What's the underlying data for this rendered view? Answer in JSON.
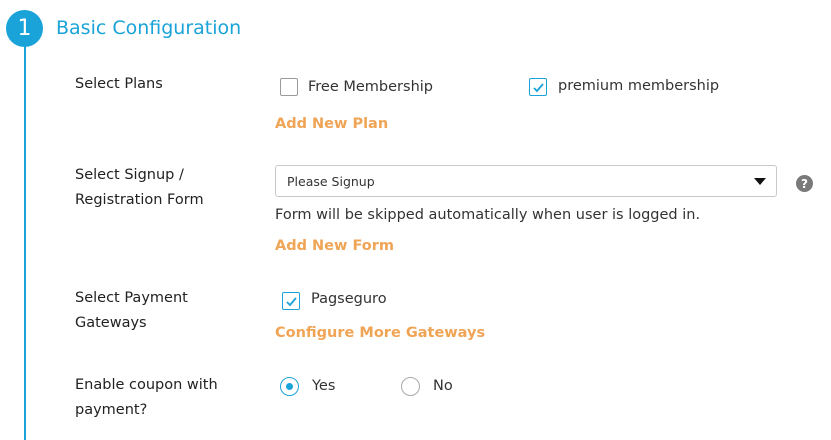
{
  "step": {
    "number": "1",
    "title": "Basic Configuration"
  },
  "plans": {
    "label": "Select Plans",
    "options": [
      {
        "label": "Free Membership",
        "checked": false
      },
      {
        "label": "premium membership",
        "checked": true
      }
    ],
    "add_link": "Add New Plan"
  },
  "signup": {
    "label_line1": "Select Signup /",
    "label_line2": "Registration Form",
    "selected": "Please Signup",
    "hint": "Form will be skipped automatically when user is logged in.",
    "help_symbol": "?",
    "add_link": "Add New Form"
  },
  "payment": {
    "label_line1": "Select Payment",
    "label_line2": "Gateways",
    "options": [
      {
        "label": "Pagseguro",
        "checked": true
      }
    ],
    "configure_link": "Configure More Gateways"
  },
  "coupon": {
    "label_line1": "Enable coupon with",
    "label_line2": "payment?",
    "options": [
      {
        "label": "Yes",
        "selected": true
      },
      {
        "label": "No",
        "selected": false
      }
    ]
  },
  "colors": {
    "accent": "#1aa3d9",
    "link": "#f0a455"
  }
}
